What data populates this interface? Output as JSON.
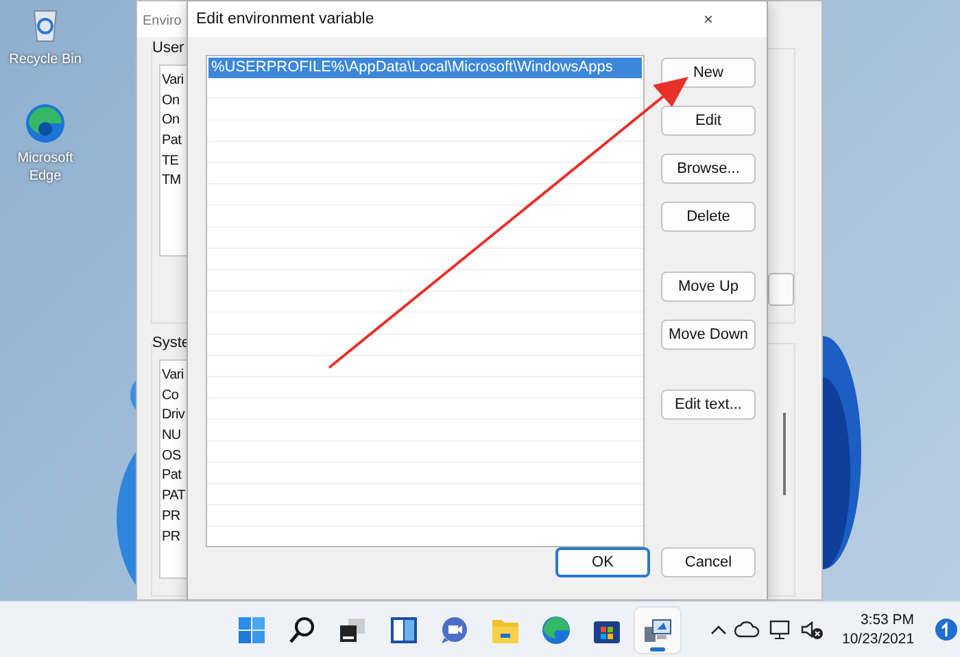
{
  "desktop_icons": [
    {
      "label": "Recycle Bin",
      "kind": "recycle"
    },
    {
      "label": "Microsoft Edge",
      "kind": "edge"
    }
  ],
  "back_window": {
    "title": "Enviro",
    "user_group": {
      "label": "User",
      "rows": [
        "Vari",
        "On",
        "On",
        "Pat",
        "TE",
        "TM"
      ]
    },
    "system_group": {
      "label": "Syste",
      "rows": [
        "Vari",
        "Co",
        "Driv",
        "NU",
        "OS",
        "Pat",
        "PAT",
        "PR",
        "PR"
      ]
    }
  },
  "dialog": {
    "title": "Edit environment variable",
    "close": "×",
    "entries": [
      {
        "text": "%USERPROFILE%\\AppData\\Local\\Microsoft\\WindowsApps",
        "selected": true
      }
    ],
    "button_groups": [
      [
        "New",
        "Edit",
        "Browse...",
        "Delete"
      ],
      [
        "Move Up",
        "Move Down"
      ],
      [
        "Edit text..."
      ]
    ],
    "footer": [
      {
        "label": "OK",
        "default": true
      },
      {
        "label": "Cancel",
        "default": false
      }
    ]
  },
  "taskbar": {
    "items": [
      {
        "kind": "start",
        "selected": false
      },
      {
        "kind": "search",
        "selected": false
      },
      {
        "kind": "taskview",
        "selected": false
      },
      {
        "kind": "widgets",
        "selected": false
      },
      {
        "kind": "chat",
        "selected": false
      },
      {
        "kind": "explorer",
        "selected": false
      },
      {
        "kind": "edge",
        "selected": false
      },
      {
        "kind": "store",
        "selected": false
      },
      {
        "kind": "computer",
        "selected": true
      }
    ],
    "time": "3:53 PM",
    "date": "10/23/2021"
  }
}
